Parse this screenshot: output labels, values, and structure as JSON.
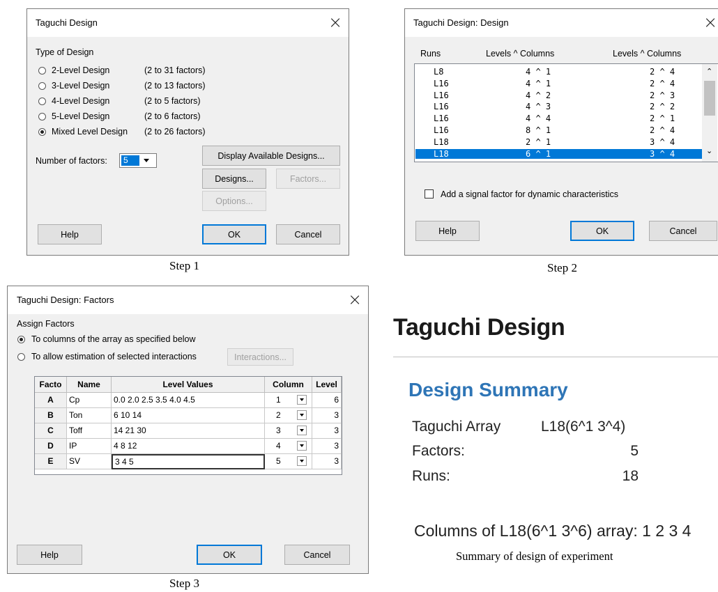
{
  "step1": {
    "title": "Taguchi Design",
    "type_label": "Type of Design",
    "options": [
      {
        "label": "2-Level Design",
        "range": "(2 to 31 factors)",
        "selected": false
      },
      {
        "label": "3-Level Design",
        "range": "(2 to 13 factors)",
        "selected": false
      },
      {
        "label": "4-Level Design",
        "range": "(2 to 5 factors)",
        "selected": false
      },
      {
        "label": "5-Level Design",
        "range": "(2 to 6 factors)",
        "selected": false
      },
      {
        "label": "Mixed Level Design",
        "range": "(2 to 26 factors)",
        "selected": true
      }
    ],
    "factors_label": "Number of factors:",
    "factors_value": "5",
    "display_button": "Display Available Designs...",
    "designs_button": "Designs...",
    "factors_button": "Factors...",
    "options_button": "Options...",
    "help_button": "Help",
    "ok_button": "OK",
    "cancel_button": "Cancel",
    "caption": "Step 1"
  },
  "step2": {
    "title": "Taguchi Design: Design",
    "col_runs": "Runs",
    "col_levels1": "Levels ^ Columns",
    "col_levels2": "Levels ^ Columns",
    "rows": [
      {
        "runs": "L8",
        "a": "4 ^ 1",
        "b": "2 ^ 4",
        "selected": false
      },
      {
        "runs": "L16",
        "a": "4 ^ 1",
        "b": "2 ^ 4",
        "selected": false
      },
      {
        "runs": "L16",
        "a": "4 ^ 2",
        "b": "2 ^ 3",
        "selected": false
      },
      {
        "runs": "L16",
        "a": "4 ^ 3",
        "b": "2 ^ 2",
        "selected": false
      },
      {
        "runs": "L16",
        "a": "4 ^ 4",
        "b": "2 ^ 1",
        "selected": false
      },
      {
        "runs": "L16",
        "a": "8 ^ 1",
        "b": "2 ^ 4",
        "selected": false
      },
      {
        "runs": "L18",
        "a": "2 ^ 1",
        "b": "3 ^ 4",
        "selected": false
      },
      {
        "runs": "L18",
        "a": "6 ^ 1",
        "b": "3 ^ 4",
        "selected": true
      }
    ],
    "signal_label": "Add a signal factor for dynamic characteristics",
    "help_button": "Help",
    "ok_button": "OK",
    "cancel_button": "Cancel",
    "caption": "Step 2"
  },
  "step3": {
    "title": "Taguchi Design: Factors",
    "assign_label": "Assign Factors",
    "radio1": "To columns of the array as specified below",
    "radio2": "To allow estimation of selected interactions",
    "interactions_button": "Interactions...",
    "headers": {
      "factor": "Facto",
      "name": "Name",
      "levels": "Level Values",
      "column": "Column",
      "level": "Level"
    },
    "rows": [
      {
        "key": "A",
        "name": "Cp",
        "values": "0.0 2.0 2.5 3.5 4.0 4.5",
        "column": "1",
        "level": "6"
      },
      {
        "key": "B",
        "name": "Ton",
        "values": "6 10 14",
        "column": "2",
        "level": "3"
      },
      {
        "key": "C",
        "name": "Toff",
        "values": "14 21 30",
        "column": "3",
        "level": "3"
      },
      {
        "key": "D",
        "name": "IP",
        "values": "4 8 12",
        "column": "4",
        "level": "3"
      },
      {
        "key": "E",
        "name": "SV",
        "values": "3 4 5",
        "column": "5",
        "level": "3"
      }
    ],
    "help_button": "Help",
    "ok_button": "OK",
    "cancel_button": "Cancel",
    "caption": "Step 3"
  },
  "report": {
    "title": "Taguchi Design",
    "subtitle": "Design Summary",
    "array_label": "Taguchi Array",
    "array_value": "L18(6^1 3^4)",
    "factors_label": "Factors:",
    "factors_value": "5",
    "runs_label": "Runs:",
    "runs_value": "18",
    "columns_line": "Columns of L18(6^1 3^6) array: 1 2 3 4",
    "caption": "Summary of design of experiment",
    "accent_color": "#2e75b6"
  }
}
